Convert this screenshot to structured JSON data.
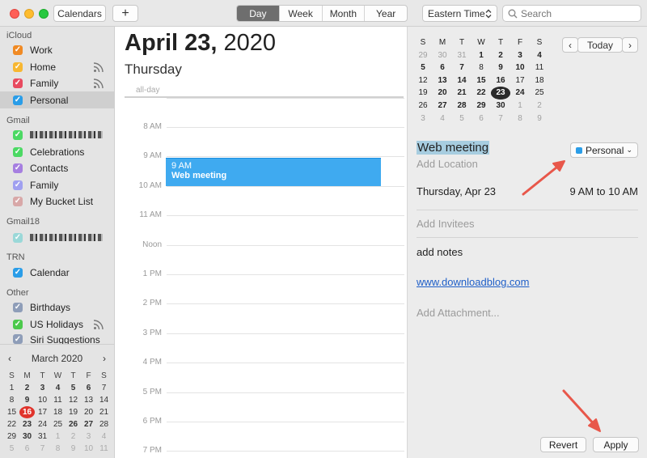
{
  "toolbar": {
    "calendars_label": "Calendars",
    "add_label": "+",
    "views": [
      "Day",
      "Week",
      "Month",
      "Year"
    ],
    "active_view": "Day",
    "timezone": "Eastern Time",
    "search_placeholder": "Search"
  },
  "sidebar": {
    "groups": [
      {
        "name": "iCloud",
        "items": [
          {
            "label": "Work",
            "color": "#f08a24",
            "shared": false
          },
          {
            "label": "Home",
            "color": "#f7b731",
            "shared": true
          },
          {
            "label": "Family",
            "color": "#e84a5f",
            "shared": true
          },
          {
            "label": "Personal",
            "color": "#2a9de8",
            "shared": false,
            "selected": true
          }
        ]
      },
      {
        "name": "Gmail",
        "items": [
          {
            "label": "",
            "color": "#4cd964",
            "redacted": true
          },
          {
            "label": "Celebrations",
            "color": "#4cd964"
          },
          {
            "label": "Contacts",
            "color": "#a67fe0"
          },
          {
            "label": "Family",
            "color": "#a0a0f0"
          },
          {
            "label": "My Bucket List",
            "color": "#d8a8a8"
          }
        ]
      },
      {
        "name": "Gmail18",
        "items": [
          {
            "label": "",
            "color": "#9ad8d8",
            "redacted": true
          }
        ]
      },
      {
        "name": "TRN",
        "items": [
          {
            "label": "Calendar",
            "color": "#2a9de8"
          }
        ]
      },
      {
        "name": "Other",
        "items": [
          {
            "label": "Birthdays",
            "color": "#8e9db8"
          },
          {
            "label": "US Holidays",
            "color": "#4cc94c",
            "shared": true
          },
          {
            "label": "Siri Suggestions",
            "color": "#8e9db8"
          }
        ]
      }
    ],
    "mini_calendar": {
      "month_label": "March 2020",
      "prev_icon": "‹",
      "next_icon": "›",
      "headers": [
        "S",
        "M",
        "T",
        "W",
        "T",
        "F",
        "S"
      ],
      "weeks": [
        [
          [
            "1",
            0,
            0
          ],
          [
            "2",
            0,
            1
          ],
          [
            "3",
            0,
            1
          ],
          [
            "4",
            0,
            1
          ],
          [
            "5",
            0,
            1
          ],
          [
            "6",
            0,
            1
          ],
          [
            "7",
            0,
            0
          ]
        ],
        [
          [
            "8",
            0,
            0
          ],
          [
            "9",
            0,
            1
          ],
          [
            "10",
            0,
            0
          ],
          [
            "11",
            0,
            0
          ],
          [
            "12",
            0,
            0
          ],
          [
            "13",
            0,
            0
          ],
          [
            "14",
            0,
            0
          ]
        ],
        [
          [
            "15",
            0,
            0
          ],
          [
            "16",
            2,
            0
          ],
          [
            "17",
            0,
            0
          ],
          [
            "18",
            0,
            0
          ],
          [
            "19",
            0,
            0
          ],
          [
            "20",
            0,
            0
          ],
          [
            "21",
            0,
            0
          ]
        ],
        [
          [
            "22",
            0,
            0
          ],
          [
            "23",
            0,
            1
          ],
          [
            "24",
            0,
            0
          ],
          [
            "25",
            0,
            0
          ],
          [
            "26",
            0,
            1
          ],
          [
            "27",
            0,
            1
          ],
          [
            "28",
            0,
            0
          ]
        ],
        [
          [
            "29",
            0,
            0
          ],
          [
            "30",
            0,
            1
          ],
          [
            "31",
            0,
            0
          ],
          [
            "1",
            1,
            0
          ],
          [
            "2",
            1,
            0
          ],
          [
            "3",
            1,
            0
          ],
          [
            "4",
            1,
            0
          ]
        ],
        [
          [
            "5",
            1,
            0
          ],
          [
            "6",
            1,
            0
          ],
          [
            "7",
            1,
            0
          ],
          [
            "8",
            1,
            0
          ],
          [
            "9",
            1,
            0
          ],
          [
            "10",
            1,
            0
          ],
          [
            "11",
            1,
            0
          ]
        ]
      ]
    }
  },
  "day": {
    "date_bold": "April 23,",
    "year": " 2020",
    "weekday": "Thursday",
    "allday_label": "all-day",
    "hours": [
      "8 AM",
      "9 AM",
      "10 AM",
      "11 AM",
      "Noon",
      "1 PM",
      "2 PM",
      "3 PM",
      "4 PM",
      "5 PM",
      "6 PM",
      "7 PM"
    ],
    "event": {
      "time": "9 AM",
      "title": "Web meeting",
      "color": "#3faaf0"
    }
  },
  "panel": {
    "today_label": "Today",
    "prev_icon": "‹",
    "next_icon": "›",
    "headers": [
      "S",
      "M",
      "T",
      "W",
      "T",
      "F",
      "S"
    ],
    "weeks": [
      [
        [
          "29",
          1,
          0
        ],
        [
          "30",
          1,
          0
        ],
        [
          "31",
          1,
          0
        ],
        [
          "1",
          0,
          1
        ],
        [
          "2",
          0,
          1
        ],
        [
          "3",
          0,
          1
        ],
        [
          "4",
          0,
          1
        ]
      ],
      [
        [
          "5",
          0,
          1
        ],
        [
          "6",
          0,
          1
        ],
        [
          "7",
          0,
          1
        ],
        [
          "8",
          0,
          0
        ],
        [
          "9",
          0,
          1
        ],
        [
          "10",
          0,
          1
        ],
        [
          "11",
          0,
          0
        ]
      ],
      [
        [
          "12",
          0,
          0
        ],
        [
          "13",
          0,
          1
        ],
        [
          "14",
          0,
          1
        ],
        [
          "15",
          0,
          1
        ],
        [
          "16",
          0,
          1
        ],
        [
          "17",
          0,
          0
        ],
        [
          "18",
          0,
          0
        ]
      ],
      [
        [
          "19",
          0,
          0
        ],
        [
          "20",
          0,
          1
        ],
        [
          "21",
          0,
          1
        ],
        [
          "22",
          0,
          1
        ],
        [
          "23",
          2,
          0
        ],
        [
          "24",
          0,
          1
        ],
        [
          "25",
          0,
          0
        ]
      ],
      [
        [
          "26",
          0,
          0
        ],
        [
          "27",
          0,
          1
        ],
        [
          "28",
          0,
          1
        ],
        [
          "29",
          0,
          1
        ],
        [
          "30",
          0,
          1
        ],
        [
          "1",
          1,
          0
        ],
        [
          "2",
          1,
          0
        ]
      ],
      [
        [
          "3",
          1,
          0
        ],
        [
          "4",
          1,
          0
        ],
        [
          "5",
          1,
          0
        ],
        [
          "6",
          1,
          0
        ],
        [
          "7",
          1,
          0
        ],
        [
          "8",
          1,
          0
        ],
        [
          "9",
          1,
          0
        ]
      ]
    ],
    "event_title": "Web meeting",
    "calendar_select": "Personal",
    "add_location": "Add Location",
    "date": "Thursday, Apr 23",
    "time": "9 AM to 10 AM",
    "add_invitees": "Add Invitees",
    "notes": "add notes",
    "url": "www.downloadblog.com",
    "add_attachment": "Add Attachment...",
    "revert_label": "Revert",
    "apply_label": "Apply",
    "arrow_color": "#e8574a"
  }
}
